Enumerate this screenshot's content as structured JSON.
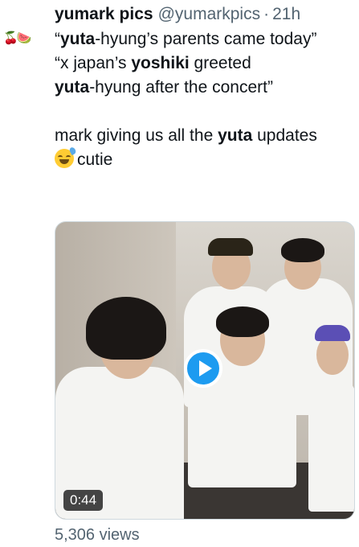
{
  "tweet": {
    "avatar_emoji": "🍒🍉",
    "author_name": "yumark pics",
    "author_handle": "@yumarkpics",
    "separator": "·",
    "timestamp": "21h",
    "lines": {
      "l1_bold": "yuta",
      "l1_rest": "-hyung’s parents came today”",
      "l1_open": "“",
      "l2_a": "“x japan’s ",
      "l2_bold": "yoshiki",
      "l2_b": " greeted",
      "l3_bold": "yuta",
      "l3_rest": "-hyung after the concert”",
      "l4_a": "mark giving us all the ",
      "l4_bold": "yuta",
      "l4_b": " updates",
      "l5": "cutie"
    },
    "emoji_name": "grinning-sweat-emoji"
  },
  "video": {
    "duration": "0:44",
    "views": "5,306 views"
  }
}
